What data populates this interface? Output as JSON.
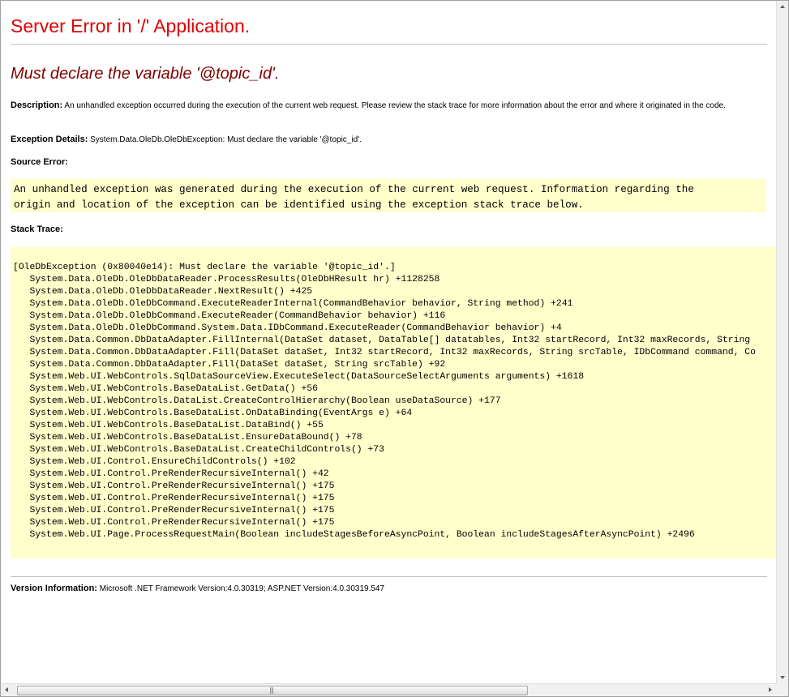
{
  "page": {
    "title": "Server Error in '/' Application.",
    "error_message": "Must declare the variable '@topic_id'."
  },
  "description": {
    "label": "Description:",
    "text": "An unhandled exception occurred during the execution of the current web request. Please review the stack trace for more information about the error and where it originated in the code."
  },
  "exception_details": {
    "label": "Exception Details:",
    "text": "System.Data.OleDb.OleDbException: Must declare the variable '@topic_id'."
  },
  "source_error": {
    "label": "Source Error:",
    "text": "An unhandled exception was generated during the execution of the current web request. Information regarding the\norigin and location of the exception can be identified using the exception stack trace below."
  },
  "stack_trace": {
    "label": "Stack Trace:",
    "lines": [
      "[OleDbException (0x80040e14): Must declare the variable '@topic_id'.]",
      "   System.Data.OleDb.OleDbDataReader.ProcessResults(OleDbHResult hr) +1128258",
      "   System.Data.OleDb.OleDbDataReader.NextResult() +425",
      "   System.Data.OleDb.OleDbCommand.ExecuteReaderInternal(CommandBehavior behavior, String method) +241",
      "   System.Data.OleDb.OleDbCommand.ExecuteReader(CommandBehavior behavior) +116",
      "   System.Data.OleDb.OleDbCommand.System.Data.IDbCommand.ExecuteReader(CommandBehavior behavior) +4",
      "   System.Data.Common.DbDataAdapter.FillInternal(DataSet dataset, DataTable[] datatables, Int32 startRecord, Int32 maxRecords, String",
      "   System.Data.Common.DbDataAdapter.Fill(DataSet dataSet, Int32 startRecord, Int32 maxRecords, String srcTable, IDbCommand command, Co",
      "   System.Data.Common.DbDataAdapter.Fill(DataSet dataSet, String srcTable) +92",
      "   System.Web.UI.WebControls.SqlDataSourceView.ExecuteSelect(DataSourceSelectArguments arguments) +1618",
      "   System.Web.UI.WebControls.BaseDataList.GetData() +56",
      "   System.Web.UI.WebControls.DataList.CreateControlHierarchy(Boolean useDataSource) +177",
      "   System.Web.UI.WebControls.BaseDataList.OnDataBinding(EventArgs e) +64",
      "   System.Web.UI.WebControls.BaseDataList.DataBind() +55",
      "   System.Web.UI.WebControls.BaseDataList.EnsureDataBound() +78",
      "   System.Web.UI.WebControls.BaseDataList.CreateChildControls() +73",
      "   System.Web.UI.Control.EnsureChildControls() +102",
      "   System.Web.UI.Control.PreRenderRecursiveInternal() +42",
      "   System.Web.UI.Control.PreRenderRecursiveInternal() +175",
      "   System.Web.UI.Control.PreRenderRecursiveInternal() +175",
      "   System.Web.UI.Control.PreRenderRecursiveInternal() +175",
      "   System.Web.UI.Control.PreRenderRecursiveInternal() +175",
      "   System.Web.UI.Page.ProcessRequestMain(Boolean includeStagesBeforeAsyncPoint, Boolean includeStagesAfterAsyncPoint) +2496"
    ]
  },
  "version_info": {
    "label": "Version Information:",
    "text": "Microsoft .NET Framework Version:4.0.30319; ASP.NET Version:4.0.30319.547"
  },
  "scrollbar": {
    "grip": "|||"
  },
  "colors": {
    "title": "#e00000",
    "message": "#800000",
    "code_background": "#ffffcc"
  }
}
